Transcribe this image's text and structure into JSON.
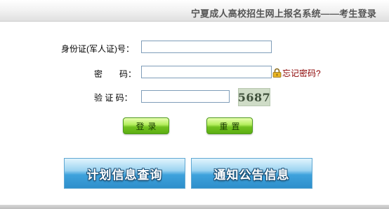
{
  "header": {
    "title": "宁夏成人高校招生网上报名系统——考生登录"
  },
  "form": {
    "id_label": "身份证(军人证)号：",
    "id_value": "",
    "password_label": "密　　码：",
    "password_value": "",
    "forgot_label": "忘记密码?",
    "captcha_label": "验 证 码：",
    "captcha_value": "",
    "captcha_text": "5687",
    "lock_icon": "lock-icon"
  },
  "buttons": {
    "login": "登录",
    "reset": "重置",
    "plan_info": "计划信息查询",
    "notice_info": "通知公告信息"
  },
  "colors": {
    "green_button": "#6cc01a",
    "blue_button": "#3ea2dc",
    "forgot_text": "#8b0000"
  }
}
